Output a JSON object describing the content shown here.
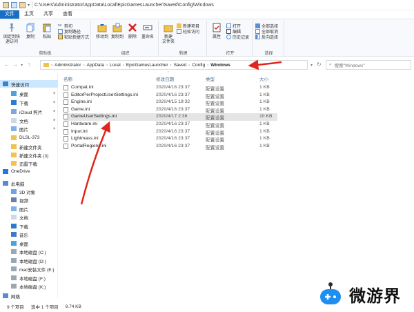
{
  "window": {
    "title_path": "C:\\Users\\Administrator\\AppData\\Local\\EpicGamesLauncher\\Saved\\Config\\Windows"
  },
  "ribbon_tabs": [
    "文件",
    "主页",
    "共享",
    "查看"
  ],
  "ribbon": {
    "clipboard": {
      "label": "剪贴板",
      "pin": "固定到快速访问",
      "copy": "复制",
      "paste": "粘贴",
      "cut": "剪切",
      "copy_path": "复制路径",
      "paste_shortcut": "粘贴快捷方式"
    },
    "organize": {
      "label": "组织",
      "move_to": "移动到",
      "copy_to": "复制到",
      "delete": "删除",
      "rename": "重命名"
    },
    "new": {
      "label": "新建",
      "new_folder": "新建\n文件夹",
      "new_item": "新建项目",
      "easy_access": "轻松访问"
    },
    "open": {
      "label": "打开",
      "properties": "属性",
      "open": "打开",
      "edit": "编辑",
      "history": "历史记录"
    },
    "select": {
      "label": "选择",
      "select_all": "全部选择",
      "select_none": "全部取消",
      "invert": "反向选择"
    }
  },
  "address": {
    "crumbs": [
      "Administrator",
      "AppData",
      "Local",
      "EpicGamesLauncher",
      "Saved",
      "Config",
      "Windows"
    ],
    "search_placeholder": "搜索\"Windows\""
  },
  "sidebar": [
    {
      "label": "快速访问",
      "pinned": false,
      "selected": true,
      "icon": "star-icon"
    },
    {
      "label": "桌面",
      "pinned": true,
      "icon": "desktop-icon"
    },
    {
      "label": "下载",
      "pinned": true,
      "icon": "download-icon"
    },
    {
      "label": "iCloud 照片",
      "pinned": true,
      "icon": "icloud-icon"
    },
    {
      "label": "文档",
      "pinned": true,
      "icon": "document-icon"
    },
    {
      "label": "图片",
      "pinned": true,
      "icon": "picture-icon"
    },
    {
      "label": "DLSL-373",
      "pinned": false,
      "icon": "folder-icon"
    },
    {
      "label": "新建文件夹",
      "pinned": false,
      "icon": "folder-icon"
    },
    {
      "label": "新建文件夹 (3)",
      "pinned": false,
      "icon": "folder-icon"
    },
    {
      "label": "迅雷下载",
      "pinned": false,
      "icon": "folder-icon"
    },
    {
      "label": "OneDrive",
      "pinned": false,
      "icon": "onedrive-icon"
    },
    {
      "label": "此电脑",
      "pinned": false,
      "icon": "pc-icon"
    },
    {
      "label": "3D 对象",
      "pinned": false,
      "icon": "3d-icon"
    },
    {
      "label": "视频",
      "pinned": false,
      "icon": "video-icon"
    },
    {
      "label": "图片",
      "pinned": false,
      "icon": "picture-icon"
    },
    {
      "label": "文档",
      "pinned": false,
      "icon": "document-icon"
    },
    {
      "label": "下载",
      "pinned": false,
      "icon": "download-icon"
    },
    {
      "label": "音乐",
      "pinned": false,
      "icon": "music-icon"
    },
    {
      "label": "桌面",
      "pinned": false,
      "icon": "desktop-icon"
    },
    {
      "label": "本地磁盘 (C:)",
      "pinned": false,
      "icon": "drive-icon"
    },
    {
      "label": "本地磁盘 (D:)",
      "pinned": false,
      "icon": "drive-icon"
    },
    {
      "label": "mac安装文件 (E:)",
      "pinned": false,
      "icon": "drive-icon"
    },
    {
      "label": "本地磁盘 (F:)",
      "pinned": false,
      "icon": "drive-icon"
    },
    {
      "label": "本地磁盘 (K:)",
      "pinned": false,
      "icon": "drive-icon"
    },
    {
      "label": "网络",
      "pinned": false,
      "icon": "network-icon"
    }
  ],
  "columns": {
    "name": "名称",
    "date": "修改日期",
    "type": "类型",
    "size": "大小"
  },
  "files": [
    {
      "name": "Compat.ini",
      "date": "2020/4/16 23:37",
      "type": "配置设置",
      "size": "1 KB"
    },
    {
      "name": "EditorPerProjectUserSettings.ini",
      "date": "2020/4/16 23:37",
      "type": "配置设置",
      "size": "1 KB"
    },
    {
      "name": "Engine.ini",
      "date": "2020/4/15 19:32",
      "type": "配置设置",
      "size": "1 KB"
    },
    {
      "name": "Game.ini",
      "date": "2020/4/16 23:37",
      "type": "配置设置",
      "size": "1 KB"
    },
    {
      "name": "GameUserSettings.ini",
      "date": "2020/4/17 2:36",
      "type": "配置设置",
      "size": "10 KB",
      "highlighted": true
    },
    {
      "name": "Hardware.ini",
      "date": "2020/4/16 23:37",
      "type": "配置设置",
      "size": "1 KB"
    },
    {
      "name": "Input.ini",
      "date": "2020/4/16 23:37",
      "type": "配置设置",
      "size": "1 KB"
    },
    {
      "name": "Lightmass.ini",
      "date": "2020/4/16 23:37",
      "type": "配置设置",
      "size": "1 KB"
    },
    {
      "name": "PortalRegions.ini",
      "date": "2020/4/16 23:37",
      "type": "配置设置",
      "size": "1 KB"
    }
  ],
  "status": {
    "count": "9 个项目",
    "selected": "选中 1 个项目",
    "size": "9.74 KB"
  },
  "watermark": {
    "text": "微游界"
  },
  "colors": {
    "accent": "#1a6fc5",
    "arrow": "#e0261b",
    "selection": "#cce8ff"
  }
}
